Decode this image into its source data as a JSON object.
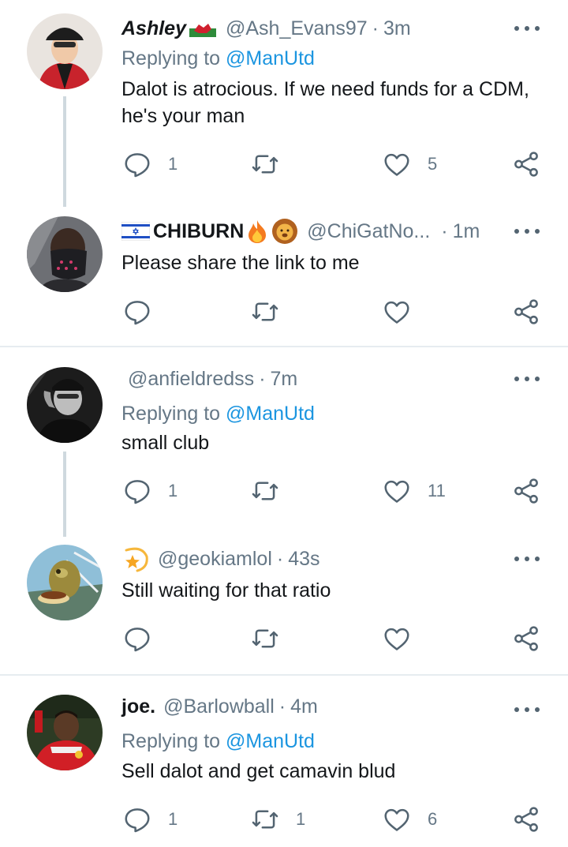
{
  "tweets": [
    {
      "name": "Ashley",
      "name_emoji": "wales-flag-icon",
      "handle": "@Ash_Evans97",
      "time": "3m",
      "replying_label": "Replying to",
      "replying_to": "@ManUtd",
      "text": "Dalot is atrocious. If we need funds for a CDM, he's your man",
      "replies": "1",
      "retweets": "",
      "likes": "5"
    },
    {
      "name": "CHIBURN",
      "name_emoji": "israel-flag-fire-lion-icons",
      "handle": "@ChiGatNo...",
      "time": "1m",
      "text": "Please share the link to me",
      "replies": "",
      "retweets": "",
      "likes": ""
    },
    {
      "name": "",
      "handle": "@anfieldredss",
      "time": "7m",
      "replying_label": "Replying to",
      "replying_to": "@ManUtd",
      "text": "small club",
      "replies": "1",
      "retweets": "",
      "likes": "11"
    },
    {
      "name": "",
      "name_emoji": "dizzy-star-icon",
      "handle": "@geokiamlol",
      "time": "43s",
      "text": "Still waiting for that ratio",
      "replies": "",
      "retweets": "",
      "likes": ""
    },
    {
      "name": "joe.",
      "handle": "@Barlowball",
      "time": "4m",
      "replying_label": "Replying to",
      "replying_to": "@ManUtd",
      "text": "Sell dalot and get camavin blud",
      "replies": "1",
      "retweets": "1",
      "likes": "6"
    }
  ],
  "colors": {
    "text_primary": "#14171a",
    "text_secondary": "#657786",
    "link": "#1b95e0",
    "icon": "#536471",
    "divider": "#e6ecf0",
    "thread_line": "#cfd9de"
  }
}
